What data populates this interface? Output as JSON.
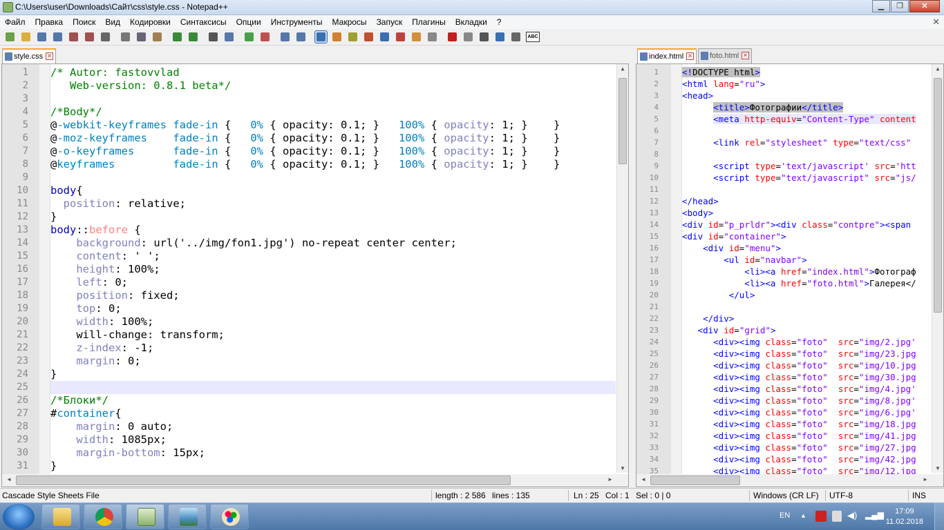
{
  "window": {
    "title": "C:\\Users\\user\\Downloads\\Сайт\\css\\style.css - Notepad++"
  },
  "menu": [
    "Файл",
    "Правка",
    "Поиск",
    "Вид",
    "Кодировки",
    "Синтаксисы",
    "Опции",
    "Инструменты",
    "Макросы",
    "Запуск",
    "Плагины",
    "Вкладки",
    "?"
  ],
  "menu_close": "✕",
  "toolbar": {
    "buttons": [
      "new",
      "open",
      "save",
      "save-all",
      "close",
      "close-all",
      "print",
      "cut",
      "copy",
      "paste",
      "undo",
      "redo",
      "find",
      "replace",
      "zoom-in",
      "zoom-out",
      "sync-v",
      "sync-h",
      "word-wrap",
      "show-all-chars",
      "indent-guide",
      "udl",
      "doc-map",
      "function-list",
      "folder-workspace",
      "monitor",
      "record-macro",
      "stop-macro",
      "play-macro",
      "run-macro-multiple",
      "save-macro",
      "spellcheck"
    ],
    "spellcheck_label": "ABC"
  },
  "left_pane": {
    "tabs": [
      {
        "label": "style.css",
        "active": true
      }
    ],
    "lines": [
      [
        [
          "/* ",
          "#008000"
        ],
        [
          "Autor",
          "#008000"
        ],
        [
          ": ",
          "#008000"
        ],
        [
          "fastovvlad",
          "#008000"
        ]
      ],
      [
        [
          "   Web-version: 0.8.1 beta*/",
          "#008000"
        ]
      ],
      [],
      [
        [
          "/*Body*/",
          "#008000"
        ]
      ],
      [
        [
          "@",
          "#000"
        ],
        [
          "-webkit-keyframes",
          "#0080c0"
        ],
        [
          " fade-in ",
          "#0080c0"
        ],
        [
          "{   ",
          "#000"
        ],
        [
          "0%",
          "#0080c0"
        ],
        [
          " { ",
          "#000"
        ],
        [
          "opacity: 0.1; }",
          "#000"
        ],
        [
          "   100%",
          "#0080c0"
        ],
        [
          " { ",
          "#000"
        ],
        [
          "opacity",
          "#8080c0"
        ],
        [
          ": 1; }    }",
          "#000"
        ]
      ],
      [
        [
          "@",
          "#000"
        ],
        [
          "-moz-keyframes",
          "#0080c0"
        ],
        [
          "    fade-in ",
          "#0080c0"
        ],
        [
          "{   ",
          "#000"
        ],
        [
          "0%",
          "#0080c0"
        ],
        [
          " { ",
          "#000"
        ],
        [
          "opacity: 0.1; }",
          "#000"
        ],
        [
          "   100%",
          "#0080c0"
        ],
        [
          " { ",
          "#000"
        ],
        [
          "opacity",
          "#8080c0"
        ],
        [
          ": 1; }    }",
          "#000"
        ]
      ],
      [
        [
          "@",
          "#000"
        ],
        [
          "-o-keyframes",
          "#0080c0"
        ],
        [
          "      fade-in ",
          "#0080c0"
        ],
        [
          "{   ",
          "#000"
        ],
        [
          "0%",
          "#0080c0"
        ],
        [
          " { ",
          "#000"
        ],
        [
          "opacity: 0.1; }",
          "#000"
        ],
        [
          "   100%",
          "#0080c0"
        ],
        [
          " { ",
          "#000"
        ],
        [
          "opacity",
          "#8080c0"
        ],
        [
          ": 1; }    }",
          "#000"
        ]
      ],
      [
        [
          "@",
          "#000"
        ],
        [
          "keyframes",
          "#0080c0"
        ],
        [
          "         fade-in ",
          "#0080c0"
        ],
        [
          "{   ",
          "#000"
        ],
        [
          "0%",
          "#0080c0"
        ],
        [
          " { ",
          "#000"
        ],
        [
          "opacity: 0.1; }",
          "#000"
        ],
        [
          "   100%",
          "#0080c0"
        ],
        [
          " { ",
          "#000"
        ],
        [
          "opacity",
          "#8080c0"
        ],
        [
          ": 1; }    }",
          "#000"
        ]
      ],
      [],
      [
        [
          "body",
          "#0000c0"
        ],
        [
          "{",
          "#000"
        ]
      ],
      [
        [
          "  position",
          "#8080c0"
        ],
        [
          ": relative;",
          "#000"
        ]
      ],
      [
        [
          "}",
          "#000"
        ]
      ],
      [
        [
          "body",
          "#0000c0"
        ],
        [
          "::",
          "#000"
        ],
        [
          "before",
          "#ff8080"
        ],
        [
          " {",
          "#000"
        ]
      ],
      [
        [
          "    background",
          "#8080c0"
        ],
        [
          ": url('../img/fon1.jpg') no-repeat center center;",
          "#000"
        ]
      ],
      [
        [
          "    content",
          "#8080c0"
        ],
        [
          ": ' ';",
          "#000"
        ]
      ],
      [
        [
          "    height",
          "#8080c0"
        ],
        [
          ": 100%;",
          "#000"
        ]
      ],
      [
        [
          "    left",
          "#8080c0"
        ],
        [
          ": 0;",
          "#000"
        ]
      ],
      [
        [
          "    position",
          "#8080c0"
        ],
        [
          ": fixed;",
          "#000"
        ]
      ],
      [
        [
          "    top",
          "#8080c0"
        ],
        [
          ": 0;",
          "#000"
        ]
      ],
      [
        [
          "    width",
          "#8080c0"
        ],
        [
          ": 100%;",
          "#000"
        ]
      ],
      [
        [
          "    will-change: transform;",
          "#000"
        ]
      ],
      [
        [
          "    z-index",
          "#8080c0"
        ],
        [
          ": -1;",
          "#000"
        ]
      ],
      [
        [
          "    margin",
          "#8080c0"
        ],
        [
          ": 0;",
          "#000"
        ]
      ],
      [
        [
          "}",
          "#000"
        ]
      ],
      [],
      [
        [
          "/*Блоки*/",
          "#008000"
        ]
      ],
      [
        [
          "#",
          "#000"
        ],
        [
          "container",
          "#0080c0"
        ],
        [
          "{",
          "#000"
        ]
      ],
      [
        [
          "    margin",
          "#8080c0"
        ],
        [
          ": 0 auto;",
          "#000"
        ]
      ],
      [
        [
          "    width",
          "#8080c0"
        ],
        [
          ": 1085px;",
          "#000"
        ]
      ],
      [
        [
          "    margin-bottom",
          "#8080c0"
        ],
        [
          ": 15px;",
          "#000"
        ]
      ],
      [
        [
          "}",
          "#000"
        ]
      ]
    ],
    "current_line": 25
  },
  "right_pane": {
    "tabs": [
      {
        "label": "index.html",
        "active": true
      },
      {
        "label": "foto.html",
        "active": false
      }
    ],
    "lines": [
      [
        [
          "<!",
          "#0000ff"
        ],
        [
          "DOCTYPE html",
          "#000"
        ],
        [
          ">",
          "#0000ff"
        ]
      ],
      [
        [
          "<html ",
          "#0000ff"
        ],
        [
          "lang",
          "#ff0000"
        ],
        [
          "=",
          "#000"
        ],
        [
          "\"ru\"",
          "#8000ff"
        ],
        [
          ">",
          "#0000ff"
        ]
      ],
      [
        [
          "<head>",
          "#0000ff"
        ]
      ],
      [
        [
          "      ",
          "#000"
        ],
        [
          "<title>",
          "#0000ff"
        ],
        [
          "Фотографии",
          "#000"
        ],
        [
          "</title>",
          "#0000ff"
        ]
      ],
      [
        [
          "      ",
          "#000"
        ],
        [
          "<meta ",
          "#0000ff"
        ],
        [
          "http-equiv",
          "#ff0000"
        ],
        [
          "=",
          "#000"
        ],
        [
          "\"Content-Type\"",
          "#8000ff"
        ],
        [
          " content",
          "#ff0000"
        ]
      ],
      [],
      [
        [
          "      ",
          "#000"
        ],
        [
          "<link ",
          "#0000ff"
        ],
        [
          "rel",
          "#ff0000"
        ],
        [
          "=",
          "#000"
        ],
        [
          "\"stylesheet\"",
          "#8000ff"
        ],
        [
          " type",
          "#ff0000"
        ],
        [
          "=",
          "#000"
        ],
        [
          "\"text/css\"",
          "#8000ff"
        ]
      ],
      [],
      [
        [
          "      ",
          "#000"
        ],
        [
          "<script ",
          "#0000ff"
        ],
        [
          "type",
          "#ff0000"
        ],
        [
          "=",
          "#000"
        ],
        [
          "'text/javascript'",
          "#8000ff"
        ],
        [
          " src",
          "#ff0000"
        ],
        [
          "=",
          "#000"
        ],
        [
          "'htt",
          "#8000ff"
        ]
      ],
      [
        [
          "      ",
          "#000"
        ],
        [
          "<script ",
          "#0000ff"
        ],
        [
          "type",
          "#ff0000"
        ],
        [
          "=",
          "#000"
        ],
        [
          "\"text/javascript\"",
          "#8000ff"
        ],
        [
          " src",
          "#ff0000"
        ],
        [
          "=",
          "#000"
        ],
        [
          "\"js/",
          "#8000ff"
        ]
      ],
      [],
      [
        [
          "</head>",
          "#0000ff"
        ]
      ],
      [
        [
          "<body>",
          "#0000ff"
        ]
      ],
      [
        [
          "<div ",
          "#0000ff"
        ],
        [
          "id",
          "#ff0000"
        ],
        [
          "=",
          "#000"
        ],
        [
          "\"p_prldr\"",
          "#8000ff"
        ],
        [
          "><div ",
          "#0000ff"
        ],
        [
          "class",
          "#ff0000"
        ],
        [
          "=",
          "#000"
        ],
        [
          "\"contpre\"",
          "#8000ff"
        ],
        [
          "><span",
          "#0000ff"
        ]
      ],
      [
        [
          "<div ",
          "#0000ff"
        ],
        [
          "id",
          "#ff0000"
        ],
        [
          "=",
          "#000"
        ],
        [
          "\"container\"",
          "#8000ff"
        ],
        [
          ">",
          "#0000ff"
        ]
      ],
      [
        [
          "    <div ",
          "#0000ff"
        ],
        [
          "id",
          "#ff0000"
        ],
        [
          "=",
          "#000"
        ],
        [
          "\"menu\"",
          "#8000ff"
        ],
        [
          ">",
          "#0000ff"
        ]
      ],
      [
        [
          "        <ul ",
          "#0000ff"
        ],
        [
          "id",
          "#ff0000"
        ],
        [
          "=",
          "#000"
        ],
        [
          "\"navbar\"",
          "#8000ff"
        ],
        [
          ">",
          "#0000ff"
        ]
      ],
      [
        [
          "            <li><a ",
          "#0000ff"
        ],
        [
          "href",
          "#ff0000"
        ],
        [
          "=",
          "#000"
        ],
        [
          "\"index.html\"",
          "#8000ff"
        ],
        [
          ">",
          "#0000ff"
        ],
        [
          "Фотограф",
          "#000"
        ]
      ],
      [
        [
          "            <li><a ",
          "#0000ff"
        ],
        [
          "href",
          "#ff0000"
        ],
        [
          "=",
          "#000"
        ],
        [
          "\"foto.html\"",
          "#8000ff"
        ],
        [
          ">",
          "#0000ff"
        ],
        [
          "Галерея</",
          "#000"
        ]
      ],
      [
        [
          "         </ul>",
          "#0000ff"
        ]
      ],
      [],
      [
        [
          "    </div>",
          "#0000ff"
        ]
      ],
      [
        [
          "   <div ",
          "#0000ff"
        ],
        [
          "id",
          "#ff0000"
        ],
        [
          "=",
          "#000"
        ],
        [
          "\"grid\"",
          "#8000ff"
        ],
        [
          ">",
          "#0000ff"
        ]
      ],
      [
        [
          "      <div><img ",
          "#0000ff"
        ],
        [
          "class",
          "#ff0000"
        ],
        [
          "=",
          "#000"
        ],
        [
          "\"foto\"",
          "#8000ff"
        ],
        [
          "  src",
          "#ff0000"
        ],
        [
          "=",
          "#000"
        ],
        [
          "\"img/2.jpg'",
          "#8000ff"
        ]
      ],
      [
        [
          "      <div><img ",
          "#0000ff"
        ],
        [
          "class",
          "#ff0000"
        ],
        [
          "=",
          "#000"
        ],
        [
          "\"foto\"",
          "#8000ff"
        ],
        [
          "  src",
          "#ff0000"
        ],
        [
          "=",
          "#000"
        ],
        [
          "\"img/23.jpg",
          "#8000ff"
        ]
      ],
      [
        [
          "      <div><img ",
          "#0000ff"
        ],
        [
          "class",
          "#ff0000"
        ],
        [
          "=",
          "#000"
        ],
        [
          "\"foto\"",
          "#8000ff"
        ],
        [
          "  src",
          "#ff0000"
        ],
        [
          "=",
          "#000"
        ],
        [
          "\"img/10.jpg",
          "#8000ff"
        ]
      ],
      [
        [
          "      <div><img ",
          "#0000ff"
        ],
        [
          "class",
          "#ff0000"
        ],
        [
          "=",
          "#000"
        ],
        [
          "\"foto\"",
          "#8000ff"
        ],
        [
          "  src",
          "#ff0000"
        ],
        [
          "=",
          "#000"
        ],
        [
          "\"img/30.jpg",
          "#8000ff"
        ]
      ],
      [
        [
          "      <div><img ",
          "#0000ff"
        ],
        [
          "class",
          "#ff0000"
        ],
        [
          "=",
          "#000"
        ],
        [
          "\"foto\"",
          "#8000ff"
        ],
        [
          "  src",
          "#ff0000"
        ],
        [
          "=",
          "#000"
        ],
        [
          "\"img/4.jpg'",
          "#8000ff"
        ]
      ],
      [
        [
          "      <div><img ",
          "#0000ff"
        ],
        [
          "class",
          "#ff0000"
        ],
        [
          "=",
          "#000"
        ],
        [
          "\"foto\"",
          "#8000ff"
        ],
        [
          "  src",
          "#ff0000"
        ],
        [
          "=",
          "#000"
        ],
        [
          "\"img/8.jpg'",
          "#8000ff"
        ]
      ],
      [
        [
          "      <div><img ",
          "#0000ff"
        ],
        [
          "class",
          "#ff0000"
        ],
        [
          "=",
          "#000"
        ],
        [
          "\"foto\"",
          "#8000ff"
        ],
        [
          "  src",
          "#ff0000"
        ],
        [
          "=",
          "#000"
        ],
        [
          "\"img/6.jpg'",
          "#8000ff"
        ]
      ],
      [
        [
          "      <div><img ",
          "#0000ff"
        ],
        [
          "class",
          "#ff0000"
        ],
        [
          "=",
          "#000"
        ],
        [
          "\"foto\"",
          "#8000ff"
        ],
        [
          "  src",
          "#ff0000"
        ],
        [
          "=",
          "#000"
        ],
        [
          "\"img/18.jpg",
          "#8000ff"
        ]
      ],
      [
        [
          "      <div><img ",
          "#0000ff"
        ],
        [
          "class",
          "#ff0000"
        ],
        [
          "=",
          "#000"
        ],
        [
          "\"foto\"",
          "#8000ff"
        ],
        [
          "  src",
          "#ff0000"
        ],
        [
          "=",
          "#000"
        ],
        [
          "\"img/41.jpg",
          "#8000ff"
        ]
      ],
      [
        [
          "      <div><img ",
          "#0000ff"
        ],
        [
          "class",
          "#ff0000"
        ],
        [
          "=",
          "#000"
        ],
        [
          "\"foto\"",
          "#8000ff"
        ],
        [
          "  src",
          "#ff0000"
        ],
        [
          "=",
          "#000"
        ],
        [
          "\"img/27.jpg",
          "#8000ff"
        ]
      ],
      [
        [
          "      <div><img ",
          "#0000ff"
        ],
        [
          "class",
          "#ff0000"
        ],
        [
          "=",
          "#000"
        ],
        [
          "\"foto\"",
          "#8000ff"
        ],
        [
          "  src",
          "#ff0000"
        ],
        [
          "=",
          "#000"
        ],
        [
          "\"img/42.jpg",
          "#8000ff"
        ]
      ],
      [
        [
          "      <div><img ",
          "#0000ff"
        ],
        [
          "class",
          "#ff0000"
        ],
        [
          "=",
          "#000"
        ],
        [
          "\"foto\"",
          "#8000ff"
        ],
        [
          "  src",
          "#ff0000"
        ],
        [
          "=",
          "#000"
        ],
        [
          "\"img/12.jpg",
          "#8000ff"
        ]
      ]
    ],
    "highlight_lines": [
      1,
      4,
      5
    ]
  },
  "status": {
    "file_type": "Cascade Style Sheets File",
    "length": "length : 2 586",
    "lines": "lines : 135",
    "ln": "Ln : 25",
    "col": "Col : 1",
    "sel": "Sel : 0 | 0",
    "eol": "Windows (CR LF)",
    "encoding": "UTF-8",
    "mode": "INS"
  },
  "taskbar": {
    "apps": [
      "explorer",
      "chrome",
      "notepad-plus-plus",
      "photo-viewer",
      "paint"
    ],
    "lang": "EN",
    "time": "17:09",
    "date": "11.02.2018"
  },
  "colors": {
    "accent_tab": "#f6a623",
    "current_line": "#e8e8ff",
    "gutter": "#e4e4e4"
  }
}
